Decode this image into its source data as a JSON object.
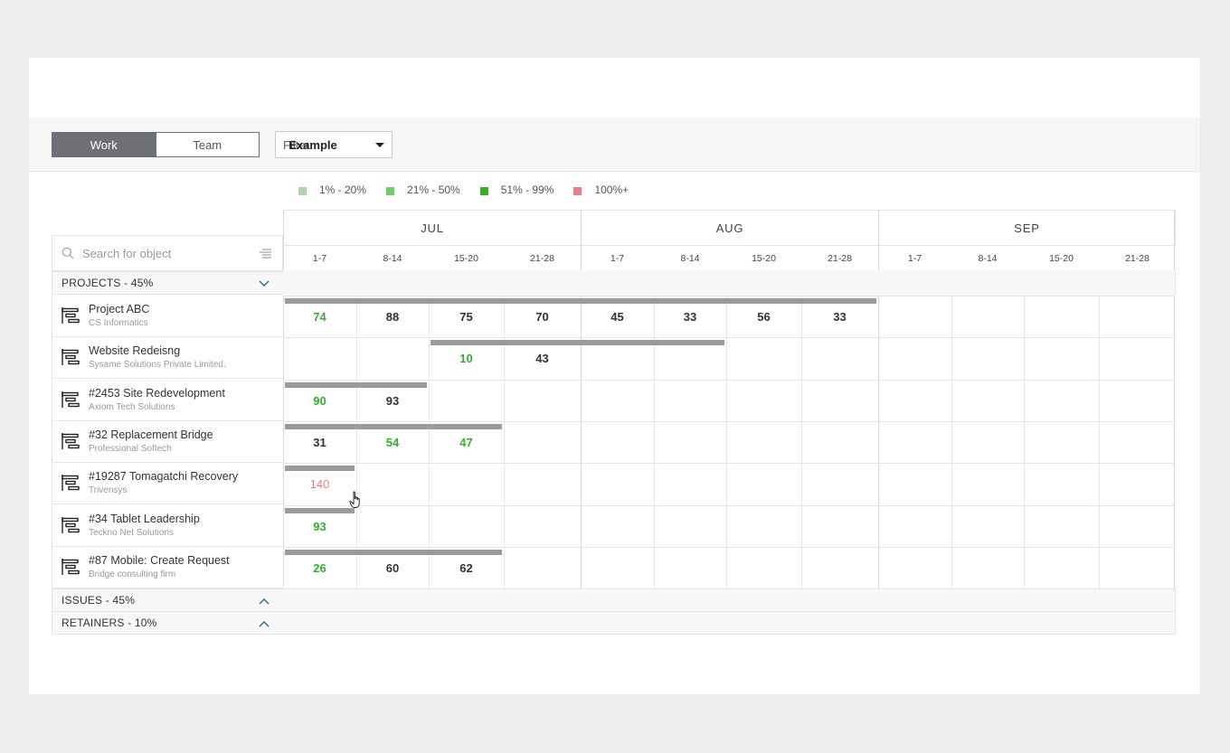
{
  "toolbar": {
    "views": [
      "Work",
      "Team"
    ],
    "active_view": "Work",
    "filter_label": "Filter:",
    "filter_value": "Example"
  },
  "legend": [
    {
      "label": "1% - 20%",
      "color": "#a8dca2"
    },
    {
      "label": "21% - 50%",
      "color": "#6fcf6a"
    },
    {
      "label": "51% - 99%",
      "color": "#2fb12a"
    },
    {
      "label": "100%+",
      "color": "#f07c80"
    }
  ],
  "search": {
    "placeholder": "Search for object"
  },
  "sections": {
    "projects": "PROJECTS - 45%",
    "issues": "ISSUES - 45%",
    "retainers": "RETAINERS - 10%"
  },
  "months": [
    "JUL",
    "AUG",
    "SEP"
  ],
  "weeks": [
    "1-7",
    "8-14",
    "15-20",
    "21-28"
  ],
  "colors": {
    "green": "#2fb12a",
    "red": "#f07c80",
    "dark": "#333333",
    "bar": "#9b9b9b"
  },
  "projects": [
    {
      "name": "Project ABC",
      "client": "CS Informatics",
      "bar": [
        0,
        8
      ],
      "cells": [
        {
          "w": 0,
          "v": "74",
          "c": "green"
        },
        {
          "w": 1,
          "v": "88",
          "c": "dark"
        },
        {
          "w": 2,
          "v": "75",
          "c": "dark"
        },
        {
          "w": 3,
          "v": "70",
          "c": "dark"
        },
        {
          "w": 4,
          "v": "45",
          "c": "dark"
        },
        {
          "w": 5,
          "v": "33",
          "c": "dark"
        },
        {
          "w": 6,
          "v": "56",
          "c": "dark"
        },
        {
          "w": 7,
          "v": "33",
          "c": "dark"
        }
      ]
    },
    {
      "name": "Website Redeisng",
      "client": "Sysame Solutions Private Limited.",
      "bar": [
        2,
        6
      ],
      "cells": [
        {
          "w": 2,
          "v": "10",
          "c": "green"
        },
        {
          "w": 3,
          "v": "43",
          "c": "dark"
        }
      ]
    },
    {
      "name": "#2453 Site Redevelopment",
      "client": "Axiom Tech Solutions",
      "bar": [
        0,
        2
      ],
      "cells": [
        {
          "w": 0,
          "v": "90",
          "c": "green"
        },
        {
          "w": 1,
          "v": "93",
          "c": "dark"
        }
      ]
    },
    {
      "name": "#32 Replacement Bridge",
      "client": "Professional Softech",
      "bar": [
        0,
        3
      ],
      "cells": [
        {
          "w": 0,
          "v": "31",
          "c": "dark"
        },
        {
          "w": 1,
          "v": "54",
          "c": "green"
        },
        {
          "w": 2,
          "v": "47",
          "c": "green"
        }
      ]
    },
    {
      "name": "#19287 Tomagatchi Recovery",
      "client": "Trivensys",
      "bar": [
        0,
        1
      ],
      "cells": [
        {
          "w": 0,
          "v": "140",
          "c": "red"
        }
      ]
    },
    {
      "name": "#34 Tablet Leadership",
      "client": "Teckno Net Solutions",
      "bar": [
        0,
        1
      ],
      "cells": [
        {
          "w": 0,
          "v": "93",
          "c": "green"
        }
      ]
    },
    {
      "name": "#87 Mobile: Create Request",
      "client": "Bridge consulting firm",
      "bar": [
        0,
        3
      ],
      "cells": [
        {
          "w": 0,
          "v": "26",
          "c": "green"
        },
        {
          "w": 1,
          "v": "60",
          "c": "dark"
        },
        {
          "w": 2,
          "v": "62",
          "c": "dark"
        }
      ]
    }
  ]
}
